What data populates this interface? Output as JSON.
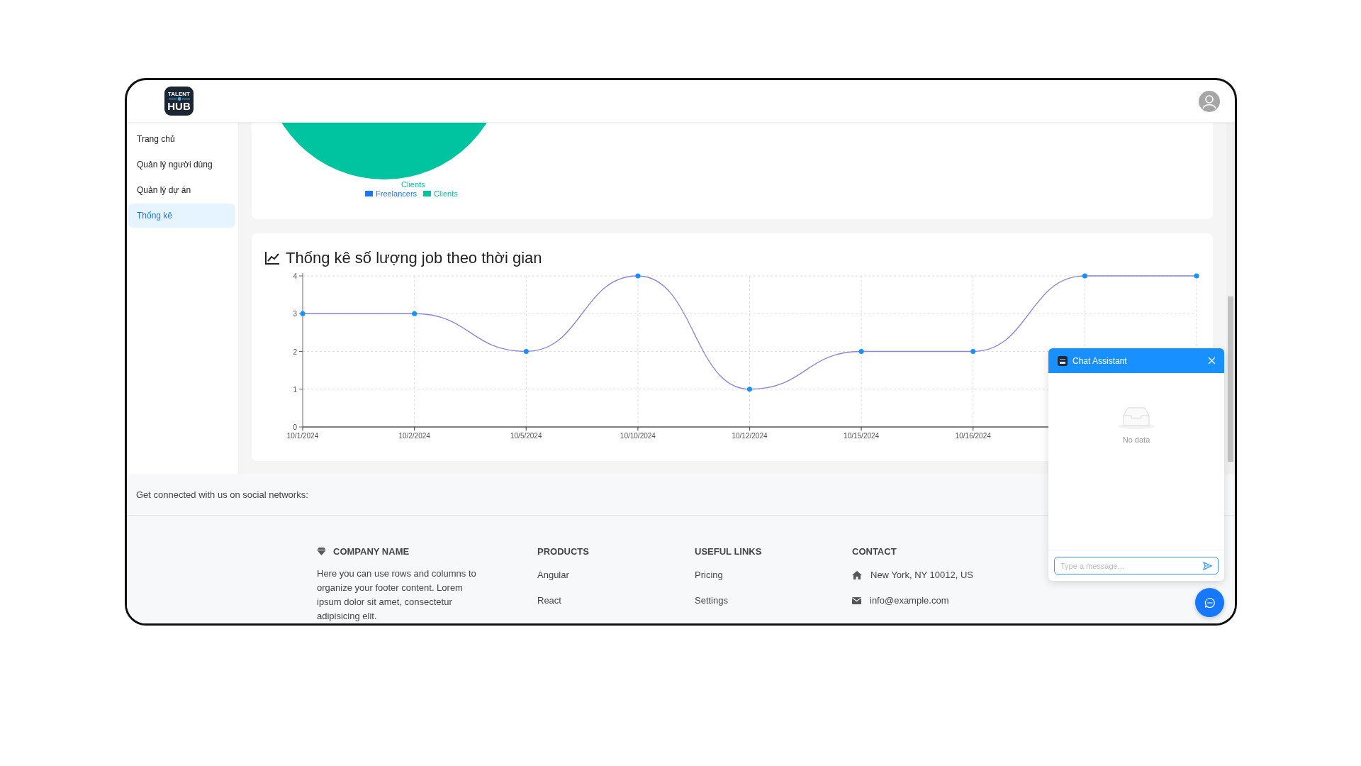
{
  "header": {
    "logo": {
      "top": "TALENT",
      "bottom": "HUB"
    }
  },
  "sidebar": {
    "items": [
      {
        "label": "Trang chủ",
        "selected": false
      },
      {
        "label": "Quản lý người dùng",
        "selected": false
      },
      {
        "label": "Quản lý dự án",
        "selected": false
      },
      {
        "label": "Thống kê",
        "selected": true
      }
    ]
  },
  "pie_card": {
    "slice_label": "Clients",
    "legend": [
      {
        "label": "Freelancers",
        "color": "#1677ff"
      },
      {
        "label": "Clients",
        "color": "#00c49f"
      }
    ]
  },
  "job_chart": {
    "title": "Thống kê số lượng job theo thời gian",
    "chart_data": {
      "type": "line",
      "categories": [
        "10/1/2024",
        "10/2/2024",
        "10/5/2024",
        "10/10/2024",
        "10/12/2024",
        "10/15/2024",
        "10/16/2024",
        null,
        null
      ],
      "series": [
        {
          "color": "#8884d8",
          "marker": true,
          "values": [
            3,
            3,
            2,
            4,
            1,
            2,
            2,
            4,
            4
          ]
        }
      ],
      "ylim": [
        0,
        4
      ],
      "yticks": [
        0,
        1,
        2,
        3,
        4
      ],
      "grid": true
    }
  },
  "footer": {
    "social_text": "Get connected with us on social networks:",
    "columns": [
      {
        "kind": "about",
        "heading": "COMPANY NAME",
        "text": "Here you can use rows and columns to organize your footer content. Lorem ipsum dolor sit amet, consectetur adipisicing elit."
      },
      {
        "kind": "links",
        "heading": "PRODUCTS",
        "links": [
          "Angular",
          "React"
        ]
      },
      {
        "kind": "links",
        "heading": "USEFUL LINKS",
        "links": [
          "Pricing",
          "Settings"
        ]
      },
      {
        "kind": "contact",
        "heading": "CONTACT",
        "items": [
          {
            "kind": "address",
            "text": "New York, NY 10012, US"
          },
          {
            "kind": "email",
            "text": "info@example.com"
          }
        ]
      }
    ]
  },
  "chat": {
    "title": "Chat Assistant",
    "empty_text": "No data",
    "input": {
      "placeholder": "Type a message..."
    }
  }
}
